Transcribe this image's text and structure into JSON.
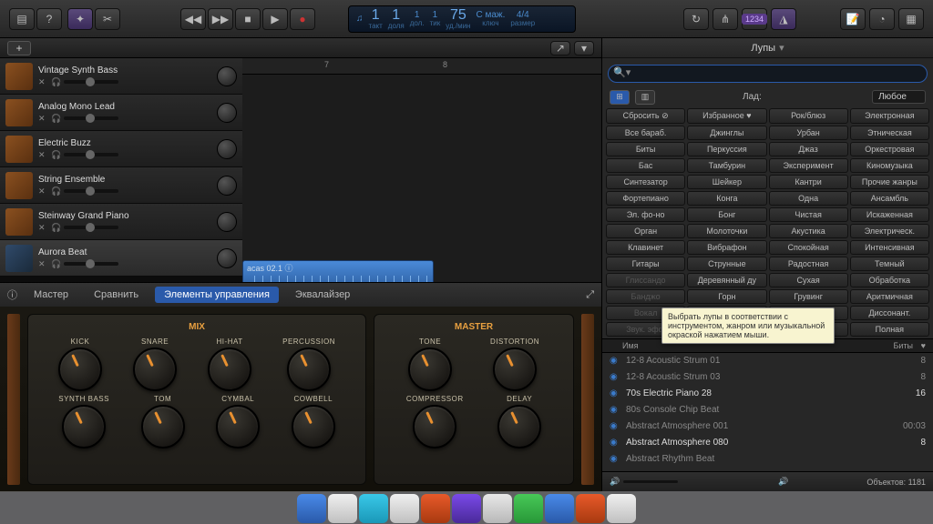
{
  "lcd": {
    "bars": "1",
    "beat": "1",
    "div": "1",
    "tick": "1",
    "tempo": "75",
    "key": "С маж.",
    "sig": "4/4",
    "l_bars": "такт",
    "l_beat": "доля",
    "l_div": "дол.",
    "l_tick": "тик",
    "l_tempo": "уд./мин",
    "l_key": "ключ",
    "l_sig": "размер"
  },
  "purple": "1234",
  "ruler": {
    "m7": "7",
    "m8": "8"
  },
  "tracks": [
    {
      "name": "Vintage Synth Bass",
      "icon": "orange"
    },
    {
      "name": "Analog Mono Lead",
      "icon": "orange"
    },
    {
      "name": "Electric Buzz",
      "icon": "orange"
    },
    {
      "name": "String Ensemble",
      "icon": "orange"
    },
    {
      "name": "Steinway Grand Piano",
      "icon": "orange"
    },
    {
      "name": "Aurora Beat",
      "icon": "blue",
      "sel": true
    }
  ],
  "region": "acas 02.1 ⓘ",
  "smart": {
    "master": "Мастер",
    "compare": "Сравнить",
    "tab_controls": "Элементы управления",
    "tab_eq": "Эквалайзер",
    "mix_title": "MIX",
    "master_title": "MASTER",
    "mix_row1": [
      "KICK",
      "SNARE",
      "HI-HAT",
      "PERCUSSION"
    ],
    "mix_row2": [
      "SYNTH BASS",
      "TOM",
      "CYMBAL",
      "COWBELL"
    ],
    "master_row1": [
      "TONE",
      "DISTORTION"
    ],
    "master_row2": [
      "COMPRESSOR",
      "DELAY"
    ]
  },
  "loops": {
    "title": "Лупы",
    "search_ph": "",
    "scale_label": "Лад:",
    "scale_value": "Любое",
    "tags": [
      [
        "Сбросить ⊘",
        "Избранное ♥",
        "Рок/блюз",
        "Электронная"
      ],
      [
        "Все бараб.",
        "Джинглы",
        "Урбан",
        "Этническая"
      ],
      [
        "Биты",
        "Перкуссия",
        "Джаз",
        "Оркестровая"
      ],
      [
        "Бас",
        "Тамбурин",
        "Эксперимент",
        "Киномузыка"
      ],
      [
        "Синтезатор",
        "Шейкер",
        "Кантри",
        "Прочие жанры"
      ],
      [
        "Фортепиано",
        "Конга",
        "Одна",
        "Ансамбль"
      ],
      [
        "Эл. фо-но",
        "Бонг",
        "Чистая",
        "Искаженная"
      ],
      [
        "Орган",
        "Молоточки",
        "Акустика",
        "Электрическ."
      ],
      [
        "Клавинет",
        "Вибрафон",
        "Спокойная",
        "Интенсивная"
      ],
      [
        "Гитары",
        "Струнные",
        "Радостная",
        "Темный"
      ],
      [
        "Глиссандо",
        "Деревянный ду",
        "Сухая",
        "Обработка"
      ],
      [
        "Банджо",
        "Горн",
        "Грувинг",
        "Аритмичная"
      ],
      [
        "Вокал",
        "",
        "",
        "Диссонант."
      ],
      [
        "Звук. эфф",
        "",
        "",
        "Полная"
      ]
    ],
    "tooltip": "Выбрать лупы в соответствии с инструментом, жанром или музыкальной окраской нажатием мыши.",
    "col_name": "Имя",
    "col_beats": "Биты",
    "items": [
      {
        "n": "12-8 Acoustic Strum 01",
        "b": "8"
      },
      {
        "n": "12-8 Acoustic Strum 03",
        "b": "8"
      },
      {
        "n": "70s Electric Piano 28",
        "b": "16",
        "bright": true
      },
      {
        "n": "80s Console Chip Beat",
        "b": ""
      },
      {
        "n": "Abstract Atmosphere 001",
        "b": "00:03"
      },
      {
        "n": "Abstract Atmosphere 080",
        "b": "8",
        "bright": true
      },
      {
        "n": "Abstract Rhythm Beat",
        "b": ""
      }
    ],
    "footer_obj": "Объектов: 1181"
  }
}
